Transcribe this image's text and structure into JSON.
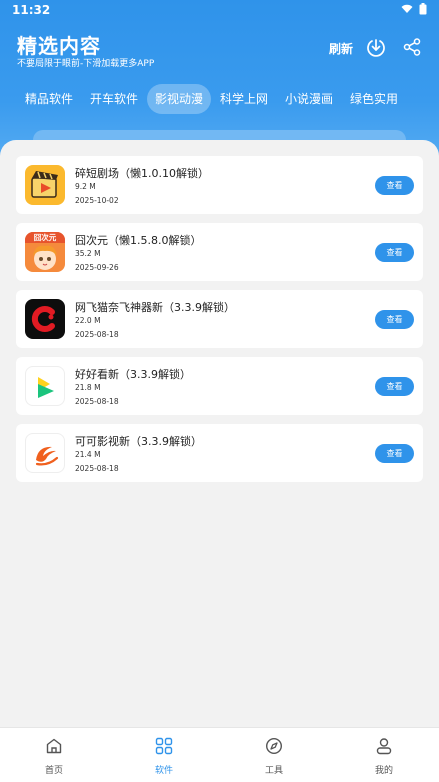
{
  "statusbar": {
    "time": "11:32"
  },
  "header": {
    "title": "精选内容",
    "subtitle": "不要局限于眼前-下滑加载更多APP",
    "refresh_label": "刷新"
  },
  "tabs": [
    {
      "label": "精品软件",
      "active": false
    },
    {
      "label": "开车软件",
      "active": false
    },
    {
      "label": "影视动漫",
      "active": true
    },
    {
      "label": "科学上网",
      "active": false
    },
    {
      "label": "小说漫画",
      "active": false
    },
    {
      "label": "绿色实用",
      "active": false
    }
  ],
  "apps": [
    {
      "name": "碎短剧场（懒1.0.10解锁）",
      "size": "9.2 M",
      "date": "2025-10-02",
      "button": "查看",
      "icon": "clapperboard-play-icon"
    },
    {
      "name": "囧次元（懒1.5.8.0解锁）",
      "size": "35.2 M",
      "date": "2025-09-26",
      "button": "查看",
      "icon": "anime-girl-icon",
      "icon_text": "囧次元"
    },
    {
      "name": "网飞猫奈飞神器新（3.3.9解锁）",
      "size": "22.0 M",
      "date": "2025-08-18",
      "button": "查看",
      "icon": "netflix-cat-icon"
    },
    {
      "name": "好好看新（3.3.9解锁）",
      "size": "21.8 M",
      "date": "2025-08-18",
      "button": "查看",
      "icon": "play-triangle-icon"
    },
    {
      "name": "可可影视新（3.3.9解锁）",
      "size": "21.4 M",
      "date": "2025-08-18",
      "button": "查看",
      "icon": "swoosh-logo-icon"
    }
  ],
  "bottom_nav": [
    {
      "label": "首页",
      "icon": "home-icon",
      "active": false
    },
    {
      "label": "软件",
      "icon": "grid-icon",
      "active": true
    },
    {
      "label": "工具",
      "icon": "compass-icon",
      "active": false
    },
    {
      "label": "我的",
      "icon": "user-icon",
      "active": false
    }
  ],
  "colors": {
    "accent": "#2f93ea",
    "background": "#f2f2f2"
  }
}
